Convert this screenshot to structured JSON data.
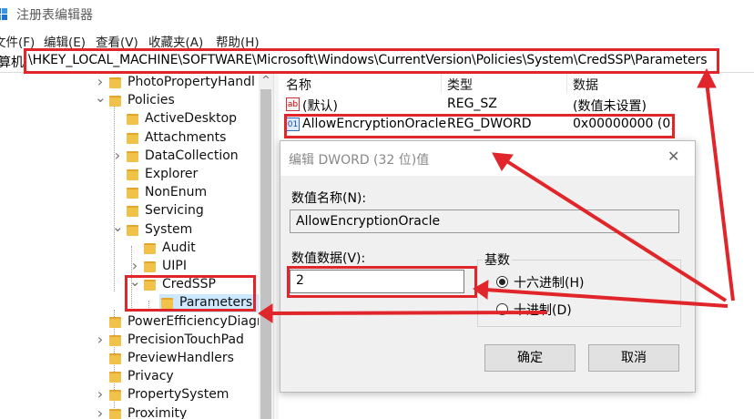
{
  "window": {
    "title": "注册表编辑器",
    "icon": "registry-editor-icon"
  },
  "menu": [
    "文件(F)",
    "编辑(E)",
    "查看(V)",
    "收藏夹(A)",
    "帮助(H)"
  ],
  "address": {
    "prefix": "算机",
    "path": "\\HKEY_LOCAL_MACHINE\\SOFTWARE\\Microsoft\\Windows\\CurrentVersion\\Policies\\System\\CredSSP\\Parameters"
  },
  "tree": [
    {
      "label": "PhotoPropertyHandl",
      "expander": ">"
    },
    {
      "label": "Policies",
      "expander": "v"
    },
    {
      "label": "ActiveDesktop",
      "expander": ""
    },
    {
      "label": "Attachments",
      "expander": ""
    },
    {
      "label": "DataCollection",
      "expander": ">"
    },
    {
      "label": "Explorer",
      "expander": ""
    },
    {
      "label": "NonEnum",
      "expander": ""
    },
    {
      "label": "Servicing",
      "expander": ""
    },
    {
      "label": "System",
      "expander": "v"
    },
    {
      "label": "Audit",
      "expander": ""
    },
    {
      "label": "UIPI",
      "expander": ">"
    },
    {
      "label": "CredSSP",
      "expander": "v"
    },
    {
      "label": "Parameters",
      "expander": ""
    },
    {
      "label": "PowerEfficiencyDiagr",
      "expander": ""
    },
    {
      "label": "PrecisionTouchPad",
      "expander": ">"
    },
    {
      "label": "PreviewHandlers",
      "expander": ""
    },
    {
      "label": "Privacy",
      "expander": ""
    },
    {
      "label": "PropertySystem",
      "expander": ">"
    },
    {
      "label": "Proximity",
      "expander": ">"
    }
  ],
  "list": {
    "headers": {
      "name": "名称",
      "type": "类型",
      "data": "数据"
    },
    "rows": [
      {
        "name": "(默认)",
        "type": "REG_SZ",
        "data": "(数值未设置)",
        "icon": "string-value-icon"
      },
      {
        "name": "AllowEncryptionOracle",
        "type": "REG_DWORD",
        "data": "0x00000000 (0)",
        "icon": "dword-value-icon"
      }
    ]
  },
  "dialog": {
    "title": "编辑 DWORD (32 位)值",
    "value_name_label": "数值名称(N):",
    "value_name": "AllowEncryptionOracle",
    "value_data_label": "数值数据(V):",
    "value_data": "2",
    "base_label": "基数",
    "hex_label": "十六进制(H)",
    "dec_label": "十进制(D)",
    "selected_base": "hex",
    "ok_label": "确定",
    "cancel_label": "取消"
  },
  "colors": {
    "highlight": "#e0262a",
    "folder": "#f0c24a",
    "selection": "#cce8ff"
  }
}
